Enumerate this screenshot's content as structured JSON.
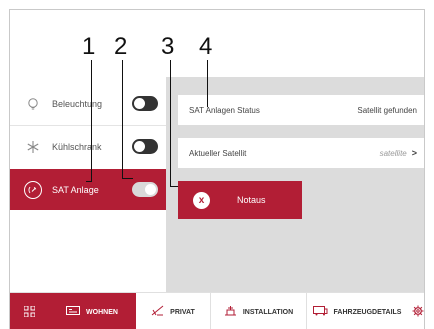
{
  "callouts": [
    "1",
    "2",
    "3",
    "4"
  ],
  "sidebar": {
    "items": [
      {
        "label": "Beleuchtung",
        "icon": "lightbulb-icon",
        "toggle_on": false,
        "active": false
      },
      {
        "label": "Kühlschrank",
        "icon": "snowflake-icon",
        "toggle_on": false,
        "active": false
      },
      {
        "label": "SAT Anlage",
        "icon": "satellite-dish-icon",
        "toggle_on": true,
        "active": true
      }
    ]
  },
  "main": {
    "status_label": "SAT Anlagen Status",
    "status_value": "Satellit gefunden",
    "satellite_label": "Aktueller Satellit",
    "satellite_value": "satellite",
    "chevron": ">",
    "notaus_icon": "x",
    "notaus_label": "Notaus"
  },
  "bottom_nav": {
    "grid_icon": "grid-icon",
    "tabs": [
      {
        "label": "WOHNEN",
        "icon": "living-icon",
        "active": true
      },
      {
        "label": "PRIVAT",
        "icon": "privacy-icon",
        "active": false
      },
      {
        "label": "INSTALLATION",
        "icon": "installation-icon",
        "active": false
      },
      {
        "label": "FAHRZEUGDETAILS",
        "icon": "vehicle-icon",
        "active": false
      }
    ],
    "settings_icon": "gear-icon"
  },
  "colors": {
    "accent": "#b21e35",
    "panel": "#dcdcdc",
    "toggle_off": "#333333"
  }
}
